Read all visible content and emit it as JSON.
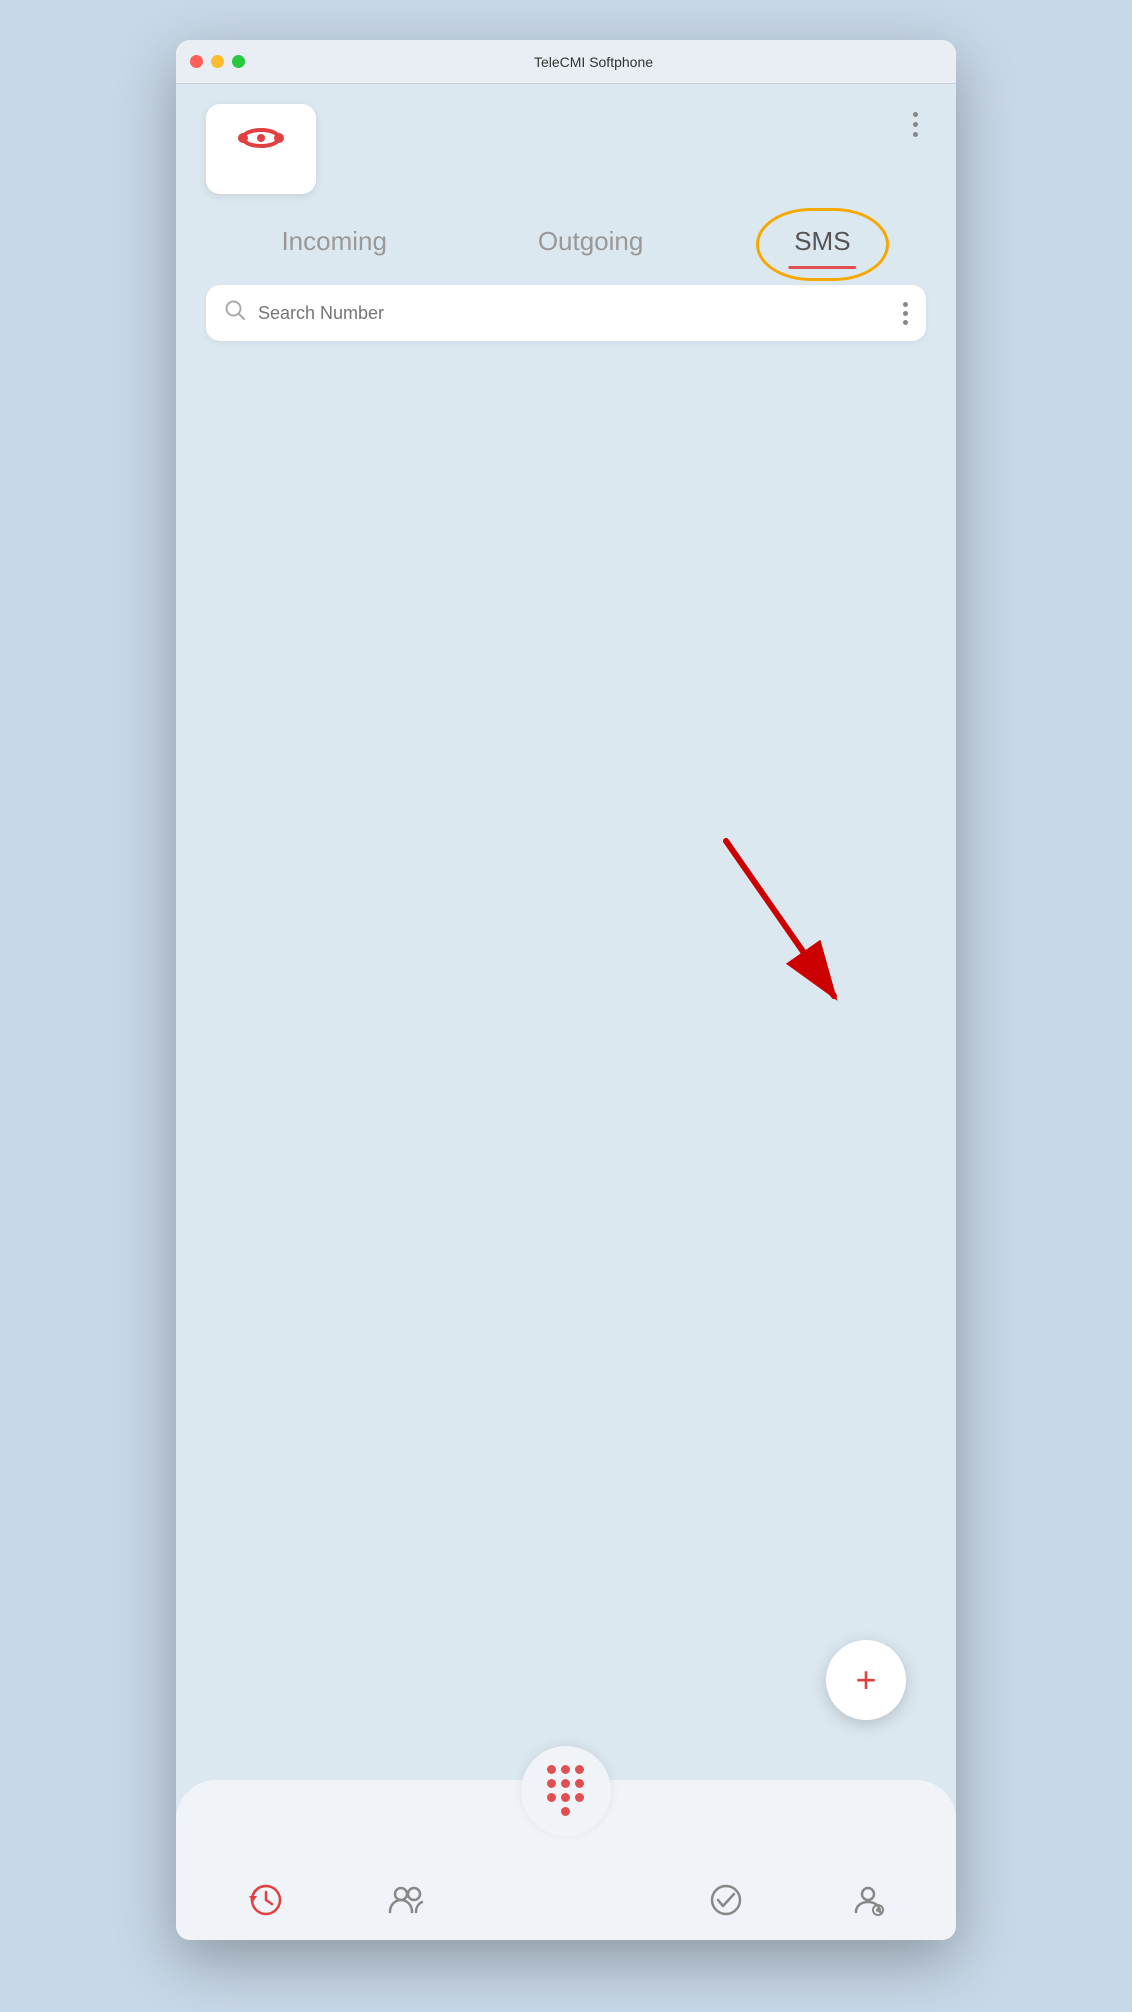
{
  "window": {
    "title": "TeleCMI Softphone",
    "controls": {
      "close": "close",
      "minimize": "minimize",
      "maximize": "maximize"
    }
  },
  "header": {
    "more_icon": "⋮"
  },
  "tabs": {
    "incoming": "Incoming",
    "outgoing": "Outgoing",
    "sms": "SMS",
    "active": "sms"
  },
  "search": {
    "placeholder": "Search Number",
    "more_icon": "⋮"
  },
  "fab": {
    "label": "+"
  },
  "bottom_nav": {
    "history": "history-icon",
    "contacts": "contacts-icon",
    "dialpad": "dialpad-icon",
    "status": "status-icon",
    "settings": "settings-icon"
  }
}
